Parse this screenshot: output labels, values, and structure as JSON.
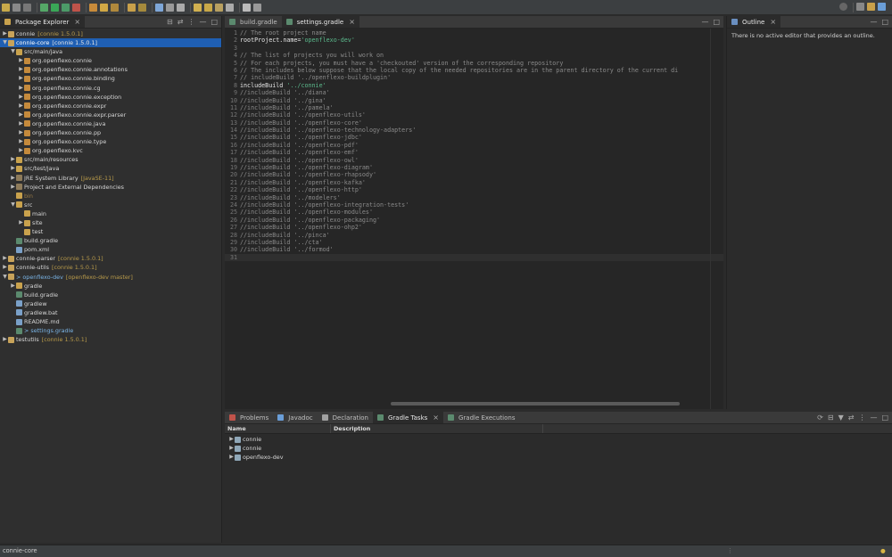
{
  "package_explorer": {
    "tab_label": "Package Explorer",
    "rows": [
      {
        "indent": 0,
        "tw": "▶",
        "icon": "proj",
        "label": "connie",
        "dec": "[connie 1.5.0.1]",
        "sel": false
      },
      {
        "indent": 0,
        "tw": "▼",
        "icon": "proj",
        "label": "connie-core",
        "dec": "[connie 1.5.0.1]",
        "sel": true
      },
      {
        "indent": 1,
        "tw": "▼",
        "icon": "folder",
        "label": "src/main/java",
        "dec": "",
        "sel": false
      },
      {
        "indent": 2,
        "tw": "▶",
        "icon": "pkg",
        "label": "org.openflexo.connie",
        "dec": "",
        "sel": false
      },
      {
        "indent": 2,
        "tw": "▶",
        "icon": "pkg",
        "label": "org.openflexo.connie.annotations",
        "dec": "",
        "sel": false
      },
      {
        "indent": 2,
        "tw": "▶",
        "icon": "pkg",
        "label": "org.openflexo.connie.binding",
        "dec": "",
        "sel": false
      },
      {
        "indent": 2,
        "tw": "▶",
        "icon": "pkg",
        "label": "org.openflexo.connie.cg",
        "dec": "",
        "sel": false
      },
      {
        "indent": 2,
        "tw": "▶",
        "icon": "pkg",
        "label": "org.openflexo.connie.exception",
        "dec": "",
        "sel": false
      },
      {
        "indent": 2,
        "tw": "▶",
        "icon": "pkg",
        "label": "org.openflexo.connie.expr",
        "dec": "",
        "sel": false
      },
      {
        "indent": 2,
        "tw": "▶",
        "icon": "pkg",
        "label": "org.openflexo.connie.expr.parser",
        "dec": "",
        "sel": false
      },
      {
        "indent": 2,
        "tw": "▶",
        "icon": "pkg",
        "label": "org.openflexo.connie.java",
        "dec": "",
        "sel": false
      },
      {
        "indent": 2,
        "tw": "▶",
        "icon": "pkg",
        "label": "org.openflexo.connie.pp",
        "dec": "",
        "sel": false
      },
      {
        "indent": 2,
        "tw": "▶",
        "icon": "pkg",
        "label": "org.openflexo.connie.type",
        "dec": "",
        "sel": false
      },
      {
        "indent": 2,
        "tw": "▶",
        "icon": "pkg",
        "label": "org.openflexo.kvc",
        "dec": "",
        "sel": false
      },
      {
        "indent": 1,
        "tw": "▶",
        "icon": "folder",
        "label": "src/main/resources",
        "dec": "",
        "sel": false
      },
      {
        "indent": 1,
        "tw": "▶",
        "icon": "folder",
        "label": "src/test/java",
        "dec": "",
        "sel": false
      },
      {
        "indent": 1,
        "tw": "▶",
        "icon": "lib",
        "label": "JRE System Library",
        "dec": "[JavaSE-11]",
        "sel": false
      },
      {
        "indent": 1,
        "tw": "▶",
        "icon": "lib",
        "label": "Project and External Dependencies",
        "dec": "",
        "sel": false
      },
      {
        "indent": 1,
        "tw": "",
        "icon": "folder",
        "label": "bin",
        "dec": "",
        "sel": false,
        "dim": true
      },
      {
        "indent": 1,
        "tw": "▼",
        "icon": "folder",
        "label": "src",
        "dec": "",
        "sel": false
      },
      {
        "indent": 2,
        "tw": "",
        "icon": "folder",
        "label": "main",
        "dec": "",
        "sel": false
      },
      {
        "indent": 2,
        "tw": "▶",
        "icon": "folder",
        "label": "site",
        "dec": "",
        "sel": false
      },
      {
        "indent": 2,
        "tw": "",
        "icon": "folder",
        "label": "test",
        "dec": "",
        "sel": false
      },
      {
        "indent": 1,
        "tw": "",
        "icon": "gradlefile",
        "label": "build.gradle",
        "dec": "",
        "sel": false
      },
      {
        "indent": 1,
        "tw": "",
        "icon": "file",
        "label": "pom.xml",
        "dec": "",
        "sel": false
      },
      {
        "indent": 0,
        "tw": "▶",
        "icon": "proj",
        "label": "connie-parser",
        "dec": "[connie 1.5.0.1]",
        "sel": false
      },
      {
        "indent": 0,
        "tw": "▶",
        "icon": "proj",
        "label": "connie-utils",
        "dec": "[connie 1.5.0.1]",
        "sel": false
      },
      {
        "indent": 0,
        "tw": "▼",
        "icon": "proj",
        "label": "> openflexo-dev",
        "dec": "[openflexo-dev master]",
        "sel": false,
        "blue": true
      },
      {
        "indent": 1,
        "tw": "▶",
        "icon": "folder",
        "label": "gradle",
        "dec": "",
        "sel": false
      },
      {
        "indent": 1,
        "tw": "",
        "icon": "gradlefile",
        "label": "build.gradle",
        "dec": "",
        "sel": false
      },
      {
        "indent": 1,
        "tw": "",
        "icon": "file",
        "label": "gradlew",
        "dec": "",
        "sel": false
      },
      {
        "indent": 1,
        "tw": "",
        "icon": "file",
        "label": "gradlew.bat",
        "dec": "",
        "sel": false
      },
      {
        "indent": 1,
        "tw": "",
        "icon": "file",
        "label": "README.md",
        "dec": "",
        "sel": false
      },
      {
        "indent": 1,
        "tw": "",
        "icon": "gradlefile",
        "label": "> settings.gradle",
        "dec": "",
        "sel": false,
        "blue": true
      },
      {
        "indent": 0,
        "tw": "▶",
        "icon": "proj",
        "label": "testutils",
        "dec": "[connie 1.5.0.1]",
        "sel": false
      }
    ]
  },
  "editor": {
    "tabs": [
      {
        "label": "build.gradle",
        "active": false
      },
      {
        "label": "settings.gradle",
        "active": true
      }
    ],
    "lines": [
      {
        "n": "1",
        "text": "// The root project name",
        "kw": false
      },
      {
        "n": "2",
        "text": "rootProject.name='openflexo-dev'",
        "kw": true
      },
      {
        "n": "3",
        "text": "",
        "kw": false
      },
      {
        "n": "4",
        "text": "// The list of projects you will work on",
        "kw": false
      },
      {
        "n": "5",
        "text": "// For each projects, you must have a 'checkouted' version of the corresponding repository",
        "kw": false
      },
      {
        "n": "6",
        "text": "// The includes below suppose that the local copy of the needed repositories are in the parent directory of the current di",
        "kw": false
      },
      {
        "n": "7",
        "text": "// includeBuild '../openflexo-buildplugin'",
        "kw": false
      },
      {
        "n": "8",
        "text": "includeBuild '../connie'",
        "kw": true
      },
      {
        "n": "9",
        "text": "//includeBuild '../diana'",
        "kw": false
      },
      {
        "n": "10",
        "text": "//includeBuild '../gina'",
        "kw": false
      },
      {
        "n": "11",
        "text": "//includeBuild '../pamela'",
        "kw": false
      },
      {
        "n": "12",
        "text": "//includeBuild '../openflexo-utils'",
        "kw": false
      },
      {
        "n": "13",
        "text": "//includeBuild '../openflexo-core'",
        "kw": false
      },
      {
        "n": "14",
        "text": "//includeBuild '../openflexo-technology-adapters'",
        "kw": false
      },
      {
        "n": "15",
        "text": "//includeBuild '../openflexo-jdbc'",
        "kw": false
      },
      {
        "n": "16",
        "text": "//includeBuild '../openflexo-pdf'",
        "kw": false
      },
      {
        "n": "17",
        "text": "//includeBuild '../openflexo-emf'",
        "kw": false
      },
      {
        "n": "18",
        "text": "//includeBuild '../openflexo-owl'",
        "kw": false
      },
      {
        "n": "19",
        "text": "//includeBuild '../openflexo-diagram'",
        "kw": false
      },
      {
        "n": "20",
        "text": "//includeBuild '../openflexo-rhapsody'",
        "kw": false
      },
      {
        "n": "21",
        "text": "//includeBuild '../openflexo-kafka'",
        "kw": false
      },
      {
        "n": "22",
        "text": "//includeBuild '../openflexo-http'",
        "kw": false
      },
      {
        "n": "23",
        "text": "//includeBuild '../modelers'",
        "kw": false
      },
      {
        "n": "24",
        "text": "//includeBuild '../openflexo-integration-tests'",
        "kw": false
      },
      {
        "n": "25",
        "text": "//includeBuild '../openflexo-modules'",
        "kw": false
      },
      {
        "n": "26",
        "text": "//includeBuild '../openflexo-packaging'",
        "kw": false
      },
      {
        "n": "27",
        "text": "//includeBuild '../openflexo-ohp2'",
        "kw": false
      },
      {
        "n": "28",
        "text": "//includeBuild '../pinca'",
        "kw": false
      },
      {
        "n": "29",
        "text": "//includeBuild '../cta'",
        "kw": false
      },
      {
        "n": "30",
        "text": "//includeBuild '../formod'",
        "kw": false
      },
      {
        "n": "31",
        "text": "",
        "kw": false
      }
    ]
  },
  "outline": {
    "tab_label": "Outline",
    "message": "There is no active editor that provides an outline."
  },
  "bottom": {
    "tabs": [
      {
        "label": "Problems",
        "active": false
      },
      {
        "label": "Javadoc",
        "active": false
      },
      {
        "label": "Declaration",
        "active": false
      },
      {
        "label": "Gradle Tasks",
        "active": true
      },
      {
        "label": "Gradle Executions",
        "active": false
      }
    ],
    "col_name": "Name",
    "col_desc": "Description",
    "rows": [
      "connie",
      "connie",
      "openflexo-dev"
    ]
  },
  "status": {
    "text": "connie-core"
  },
  "colors": {
    "selection": "#1f5fb3",
    "decoration": "#b89a4a",
    "string": "#5bb98c"
  }
}
